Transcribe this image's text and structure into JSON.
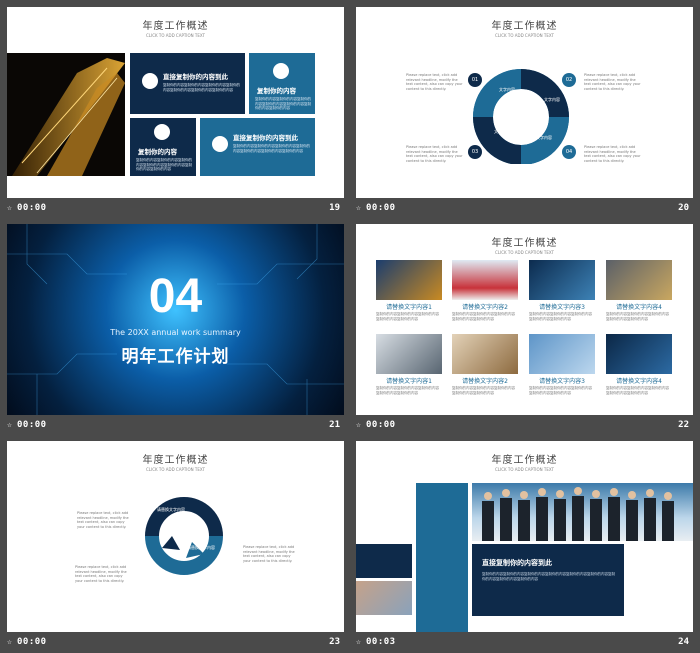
{
  "slides": [
    {
      "number": "19",
      "time": "00:00",
      "title": "年度工作概述",
      "subtitle": "CLICK TO ADD CAPTION TEXT",
      "box1_title": "直接复制你的内容到此",
      "box2_title": "复制你的内容",
      "box3_title": "复制你的内容",
      "box4_title": "直接复制你的内容到此",
      "body": "复制你的内容复制你的内容复制你的内容复制你的内容复制你的内容复制你的内容复制你的内容"
    },
    {
      "number": "20",
      "time": "00:00",
      "title": "年度工作概述",
      "subtitle": "CLICK TO ADD CAPTION TEXT",
      "seg_label": "文字内容",
      "n1": "01",
      "n2": "02",
      "n3": "03",
      "n4": "04",
      "para": "Please replace text, click add relevant headline, modify the text content, also can copy your content to this directly."
    },
    {
      "number": "21",
      "time": "00:00",
      "big": "04",
      "en": "The 20XX annual work summary",
      "zh": "明年工作计划"
    },
    {
      "number": "22",
      "time": "00:00",
      "title": "年度工作概述",
      "subtitle": "CLICK TO ADD CAPTION TEXT",
      "captions": [
        "请替换文字内容1",
        "请替换文字内容2",
        "请替换文字内容3",
        "请替换文字内容4",
        "请替换文字内容1",
        "请替换文字内容2",
        "请替换文字内容3",
        "请替换文字内容4"
      ],
      "body": "复制你的内容复制你的内容复制你的内容复制你的内容复制你的内容"
    },
    {
      "number": "23",
      "time": "00:00",
      "title": "年度工作概述",
      "subtitle": "CLICK TO ADD CAPTION TEXT",
      "labels": [
        "请替换文字内容",
        "请替换文字内容",
        "请替换文字内容"
      ],
      "para": "Please replace text, click add relevant headline, modify the text content, also can copy your content to this directly."
    },
    {
      "number": "24",
      "time": "00:03",
      "title": "年度工作概述",
      "subtitle": "CLICK TO ADD CAPTION TEXT",
      "box_title": "直接复制你的内容到此",
      "body": "复制你的内容复制你的内容复制你的内容复制你的内容复制你的内容复制你的内容复制你的内容复制你的内容复制你的内容"
    }
  ],
  "colors": {
    "navy": "#0e2a4a",
    "teal": "#1e6b96",
    "background": "#4a4a4a"
  }
}
